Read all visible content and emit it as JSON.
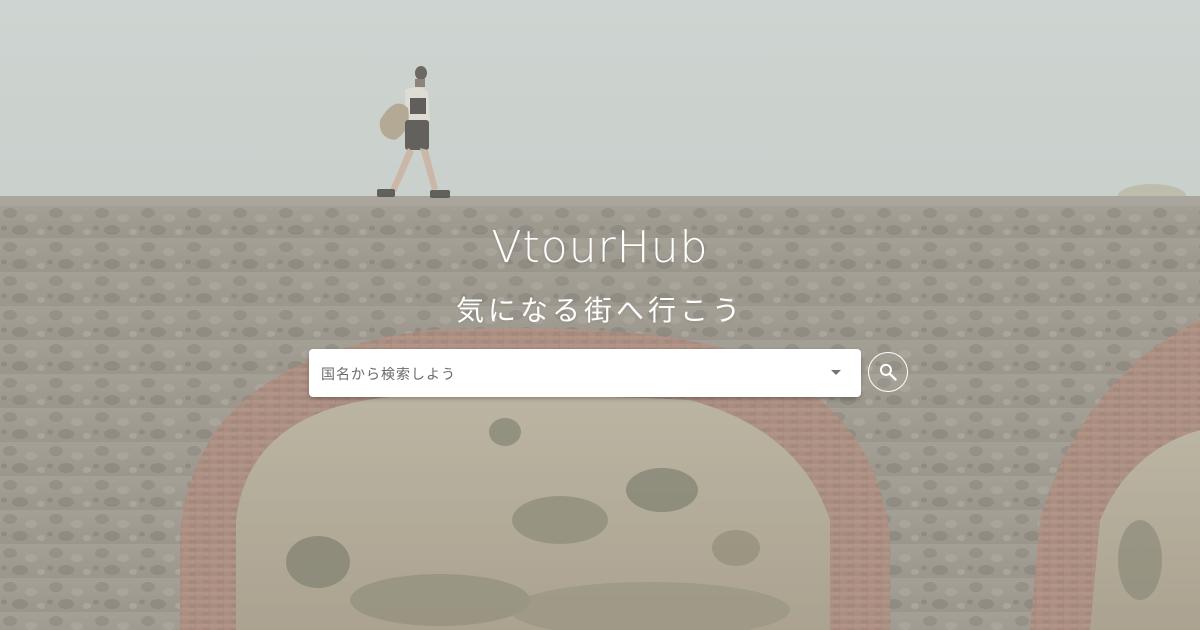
{
  "brand": {
    "title": "VtourHub"
  },
  "hero": {
    "tagline": "気になる街へ行こう",
    "background_icon": "aqueduct-walker-photo"
  },
  "search": {
    "placeholder": "国名から検索しよう",
    "dropdown_icon": "chevron-down-icon",
    "button_icon": "search-icon"
  },
  "colors": {
    "sky": "#c9d0cd",
    "stone": "#8d8479",
    "brick": "#9a6e5e",
    "hills": "#a89a83",
    "text": "#ffffff",
    "input_bg": "#ffffff",
    "placeholder": "#6b6b6b"
  }
}
